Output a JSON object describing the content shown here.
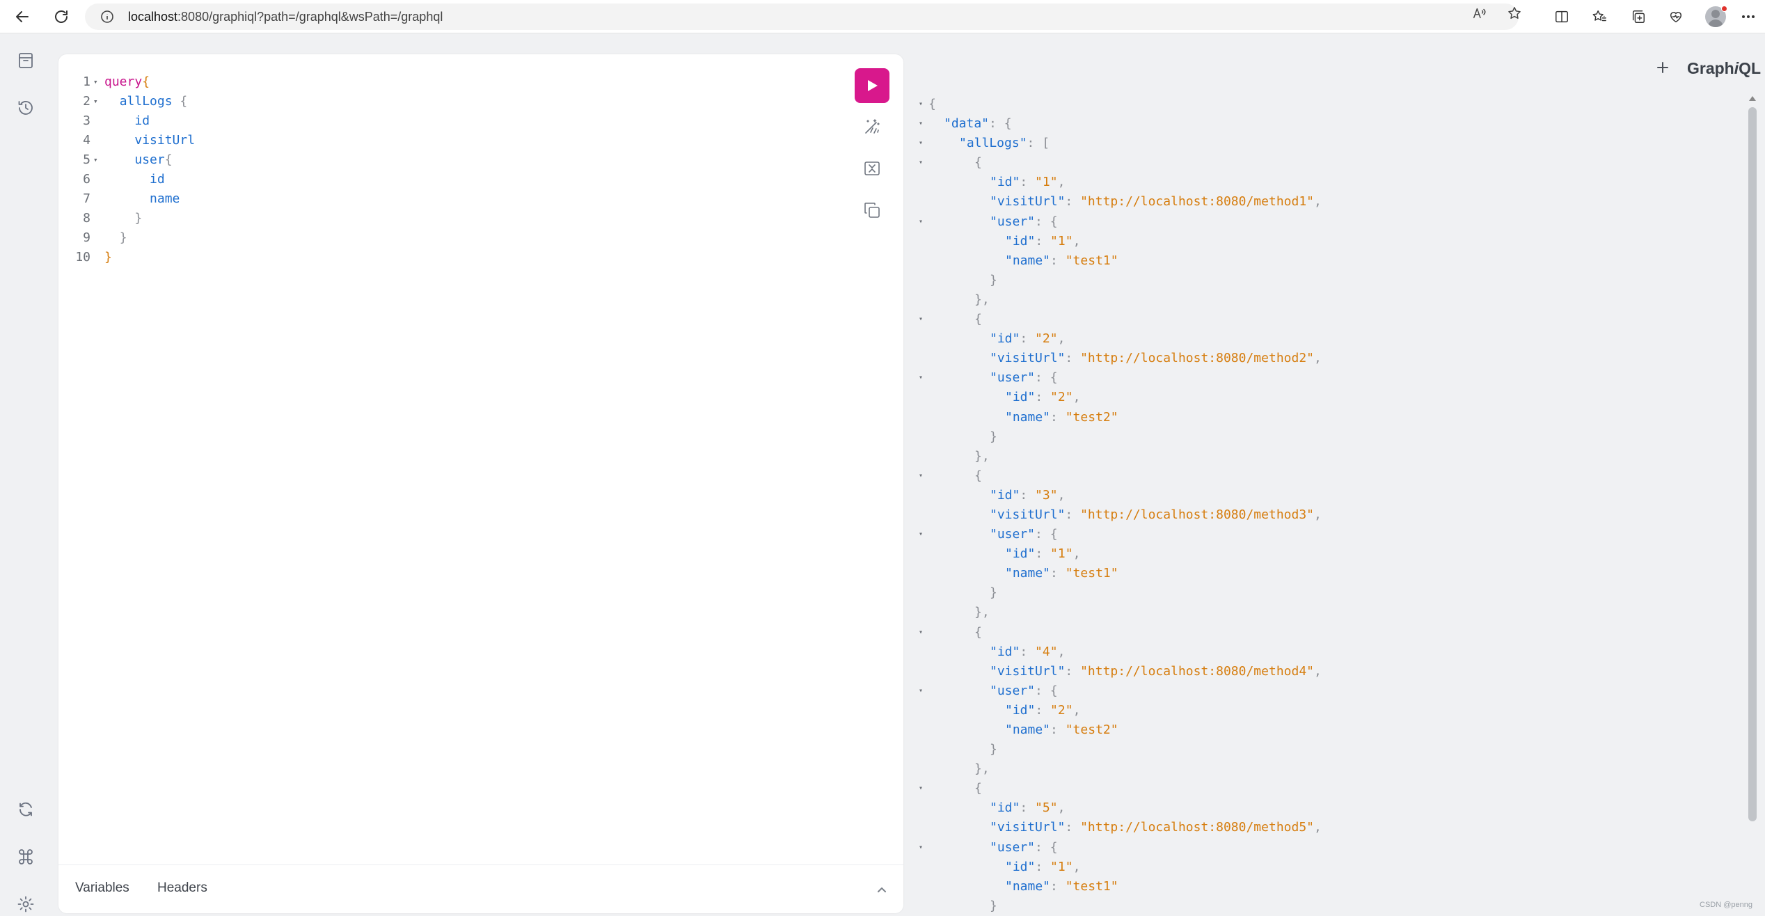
{
  "browser": {
    "url_host": "localhost",
    "url_rest": ":8080/graphiql?path=/graphql&wsPath=/graphql"
  },
  "icons": {
    "back": "back-arrow-icon",
    "reload": "reload-icon",
    "info": "info-icon",
    "read_aloud": "read-aloud-icon",
    "favorite": "star-icon",
    "split": "split-screen-icon",
    "favorites": "favorites-icon",
    "collections": "collections-icon",
    "health": "browser-essentials-icon",
    "docs": "docs-icon",
    "history": "history-icon",
    "refetch": "refetch-schema-icon",
    "shortcuts": "keyboard-shortcuts-icon",
    "settings": "settings-icon",
    "run": "play-icon",
    "prettify": "prettify-icon",
    "merge": "merge-fragments-icon",
    "copy": "copy-icon"
  },
  "editor": {
    "lines": [
      {
        "n": "1",
        "fold": "▾",
        "parts": [
          {
            "t": "query",
            "c": "kw"
          },
          {
            "t": "{",
            "c": "pn-or"
          }
        ]
      },
      {
        "n": "2",
        "fold": "▾",
        "parts": [
          {
            "t": "  ",
            "c": ""
          },
          {
            "t": "allLogs",
            "c": "fd"
          },
          {
            "t": " {",
            "c": "pn"
          }
        ]
      },
      {
        "n": "3",
        "fold": "",
        "parts": [
          {
            "t": "    ",
            "c": ""
          },
          {
            "t": "id",
            "c": "fd"
          }
        ]
      },
      {
        "n": "4",
        "fold": "",
        "parts": [
          {
            "t": "    ",
            "c": ""
          },
          {
            "t": "visitUrl",
            "c": "fd"
          }
        ]
      },
      {
        "n": "5",
        "fold": "▾",
        "parts": [
          {
            "t": "    ",
            "c": ""
          },
          {
            "t": "user",
            "c": "fd"
          },
          {
            "t": "{",
            "c": "pn"
          }
        ]
      },
      {
        "n": "6",
        "fold": "",
        "parts": [
          {
            "t": "      ",
            "c": ""
          },
          {
            "t": "id",
            "c": "fd"
          }
        ]
      },
      {
        "n": "7",
        "fold": "",
        "parts": [
          {
            "t": "      ",
            "c": ""
          },
          {
            "t": "name",
            "c": "fd"
          }
        ]
      },
      {
        "n": "8",
        "fold": "",
        "parts": [
          {
            "t": "    ",
            "c": ""
          },
          {
            "t": "}",
            "c": "pn"
          }
        ]
      },
      {
        "n": "9",
        "fold": "",
        "parts": [
          {
            "t": "  ",
            "c": ""
          },
          {
            "t": "}",
            "c": "pn"
          }
        ]
      },
      {
        "n": "10",
        "fold": "",
        "parts": [
          {
            "t": "}",
            "c": "pn-or"
          }
        ]
      }
    ],
    "tabs": {
      "variables": "Variables",
      "headers": "Headers"
    }
  },
  "result": {
    "logo_prefix": "Graph",
    "logo_italic": "i",
    "logo_suffix": "QL",
    "lines": [
      {
        "fold": "▾",
        "indent": 0,
        "parts": [
          {
            "t": "{",
            "c": ""
          }
        ]
      },
      {
        "fold": "▾",
        "indent": 1,
        "parts": [
          {
            "t": "\"data\"",
            "c": "jk"
          },
          {
            "t": ": {",
            "c": ""
          }
        ]
      },
      {
        "fold": "▾",
        "indent": 2,
        "parts": [
          {
            "t": "\"allLogs\"",
            "c": "jk"
          },
          {
            "t": ": [",
            "c": ""
          }
        ]
      },
      {
        "fold": "▾",
        "indent": 3,
        "parts": [
          {
            "t": "{",
            "c": ""
          }
        ]
      },
      {
        "fold": "",
        "indent": 4,
        "parts": [
          {
            "t": "\"id\"",
            "c": "jk"
          },
          {
            "t": ": ",
            "c": ""
          },
          {
            "t": "\"1\"",
            "c": "js"
          },
          {
            "t": ",",
            "c": ""
          }
        ]
      },
      {
        "fold": "",
        "indent": 4,
        "parts": [
          {
            "t": "\"visitUrl\"",
            "c": "jk"
          },
          {
            "t": ": ",
            "c": ""
          },
          {
            "t": "\"http://localhost:8080/method1\"",
            "c": "js"
          },
          {
            "t": ",",
            "c": ""
          }
        ]
      },
      {
        "fold": "▾",
        "indent": 4,
        "parts": [
          {
            "t": "\"user\"",
            "c": "jk"
          },
          {
            "t": ": {",
            "c": ""
          }
        ]
      },
      {
        "fold": "",
        "indent": 5,
        "parts": [
          {
            "t": "\"id\"",
            "c": "jk"
          },
          {
            "t": ": ",
            "c": ""
          },
          {
            "t": "\"1\"",
            "c": "js"
          },
          {
            "t": ",",
            "c": ""
          }
        ]
      },
      {
        "fold": "",
        "indent": 5,
        "parts": [
          {
            "t": "\"name\"",
            "c": "jk"
          },
          {
            "t": ": ",
            "c": ""
          },
          {
            "t": "\"test1\"",
            "c": "js"
          }
        ]
      },
      {
        "fold": "",
        "indent": 4,
        "parts": [
          {
            "t": "}",
            "c": ""
          }
        ]
      },
      {
        "fold": "",
        "indent": 3,
        "parts": [
          {
            "t": "},",
            "c": ""
          }
        ]
      },
      {
        "fold": "▾",
        "indent": 3,
        "parts": [
          {
            "t": "{",
            "c": ""
          }
        ]
      },
      {
        "fold": "",
        "indent": 4,
        "parts": [
          {
            "t": "\"id\"",
            "c": "jk"
          },
          {
            "t": ": ",
            "c": ""
          },
          {
            "t": "\"2\"",
            "c": "js"
          },
          {
            "t": ",",
            "c": ""
          }
        ]
      },
      {
        "fold": "",
        "indent": 4,
        "parts": [
          {
            "t": "\"visitUrl\"",
            "c": "jk"
          },
          {
            "t": ": ",
            "c": ""
          },
          {
            "t": "\"http://localhost:8080/method2\"",
            "c": "js"
          },
          {
            "t": ",",
            "c": ""
          }
        ]
      },
      {
        "fold": "▾",
        "indent": 4,
        "parts": [
          {
            "t": "\"user\"",
            "c": "jk"
          },
          {
            "t": ": {",
            "c": ""
          }
        ]
      },
      {
        "fold": "",
        "indent": 5,
        "parts": [
          {
            "t": "\"id\"",
            "c": "jk"
          },
          {
            "t": ": ",
            "c": ""
          },
          {
            "t": "\"2\"",
            "c": "js"
          },
          {
            "t": ",",
            "c": ""
          }
        ]
      },
      {
        "fold": "",
        "indent": 5,
        "parts": [
          {
            "t": "\"name\"",
            "c": "jk"
          },
          {
            "t": ": ",
            "c": ""
          },
          {
            "t": "\"test2\"",
            "c": "js"
          }
        ]
      },
      {
        "fold": "",
        "indent": 4,
        "parts": [
          {
            "t": "}",
            "c": ""
          }
        ]
      },
      {
        "fold": "",
        "indent": 3,
        "parts": [
          {
            "t": "},",
            "c": ""
          }
        ]
      },
      {
        "fold": "▾",
        "indent": 3,
        "parts": [
          {
            "t": "{",
            "c": ""
          }
        ]
      },
      {
        "fold": "",
        "indent": 4,
        "parts": [
          {
            "t": "\"id\"",
            "c": "jk"
          },
          {
            "t": ": ",
            "c": ""
          },
          {
            "t": "\"3\"",
            "c": "js"
          },
          {
            "t": ",",
            "c": ""
          }
        ]
      },
      {
        "fold": "",
        "indent": 4,
        "parts": [
          {
            "t": "\"visitUrl\"",
            "c": "jk"
          },
          {
            "t": ": ",
            "c": ""
          },
          {
            "t": "\"http://localhost:8080/method3\"",
            "c": "js"
          },
          {
            "t": ",",
            "c": ""
          }
        ]
      },
      {
        "fold": "▾",
        "indent": 4,
        "parts": [
          {
            "t": "\"user\"",
            "c": "jk"
          },
          {
            "t": ": {",
            "c": ""
          }
        ]
      },
      {
        "fold": "",
        "indent": 5,
        "parts": [
          {
            "t": "\"id\"",
            "c": "jk"
          },
          {
            "t": ": ",
            "c": ""
          },
          {
            "t": "\"1\"",
            "c": "js"
          },
          {
            "t": ",",
            "c": ""
          }
        ]
      },
      {
        "fold": "",
        "indent": 5,
        "parts": [
          {
            "t": "\"name\"",
            "c": "jk"
          },
          {
            "t": ": ",
            "c": ""
          },
          {
            "t": "\"test1\"",
            "c": "js"
          }
        ]
      },
      {
        "fold": "",
        "indent": 4,
        "parts": [
          {
            "t": "}",
            "c": ""
          }
        ]
      },
      {
        "fold": "",
        "indent": 3,
        "parts": [
          {
            "t": "},",
            "c": ""
          }
        ]
      },
      {
        "fold": "▾",
        "indent": 3,
        "parts": [
          {
            "t": "{",
            "c": ""
          }
        ]
      },
      {
        "fold": "",
        "indent": 4,
        "parts": [
          {
            "t": "\"id\"",
            "c": "jk"
          },
          {
            "t": ": ",
            "c": ""
          },
          {
            "t": "\"4\"",
            "c": "js"
          },
          {
            "t": ",",
            "c": ""
          }
        ]
      },
      {
        "fold": "",
        "indent": 4,
        "parts": [
          {
            "t": "\"visitUrl\"",
            "c": "jk"
          },
          {
            "t": ": ",
            "c": ""
          },
          {
            "t": "\"http://localhost:8080/method4\"",
            "c": "js"
          },
          {
            "t": ",",
            "c": ""
          }
        ]
      },
      {
        "fold": "▾",
        "indent": 4,
        "parts": [
          {
            "t": "\"user\"",
            "c": "jk"
          },
          {
            "t": ": {",
            "c": ""
          }
        ]
      },
      {
        "fold": "",
        "indent": 5,
        "parts": [
          {
            "t": "\"id\"",
            "c": "jk"
          },
          {
            "t": ": ",
            "c": ""
          },
          {
            "t": "\"2\"",
            "c": "js"
          },
          {
            "t": ",",
            "c": ""
          }
        ]
      },
      {
        "fold": "",
        "indent": 5,
        "parts": [
          {
            "t": "\"name\"",
            "c": "jk"
          },
          {
            "t": ": ",
            "c": ""
          },
          {
            "t": "\"test2\"",
            "c": "js"
          }
        ]
      },
      {
        "fold": "",
        "indent": 4,
        "parts": [
          {
            "t": "}",
            "c": ""
          }
        ]
      },
      {
        "fold": "",
        "indent": 3,
        "parts": [
          {
            "t": "},",
            "c": ""
          }
        ]
      },
      {
        "fold": "▾",
        "indent": 3,
        "parts": [
          {
            "t": "{",
            "c": ""
          }
        ]
      },
      {
        "fold": "",
        "indent": 4,
        "parts": [
          {
            "t": "\"id\"",
            "c": "jk"
          },
          {
            "t": ": ",
            "c": ""
          },
          {
            "t": "\"5\"",
            "c": "js"
          },
          {
            "t": ",",
            "c": ""
          }
        ]
      },
      {
        "fold": "",
        "indent": 4,
        "parts": [
          {
            "t": "\"visitUrl\"",
            "c": "jk"
          },
          {
            "t": ": ",
            "c": ""
          },
          {
            "t": "\"http://localhost:8080/method5\"",
            "c": "js"
          },
          {
            "t": ",",
            "c": ""
          }
        ]
      },
      {
        "fold": "▾",
        "indent": 4,
        "parts": [
          {
            "t": "\"user\"",
            "c": "jk"
          },
          {
            "t": ": {",
            "c": ""
          }
        ]
      },
      {
        "fold": "",
        "indent": 5,
        "parts": [
          {
            "t": "\"id\"",
            "c": "jk"
          },
          {
            "t": ": ",
            "c": ""
          },
          {
            "t": "\"1\"",
            "c": "js"
          },
          {
            "t": ",",
            "c": ""
          }
        ]
      },
      {
        "fold": "",
        "indent": 5,
        "parts": [
          {
            "t": "\"name\"",
            "c": "jk"
          },
          {
            "t": ": ",
            "c": ""
          },
          {
            "t": "\"test1\"",
            "c": "js"
          }
        ]
      },
      {
        "fold": "",
        "indent": 4,
        "parts": [
          {
            "t": "}",
            "c": ""
          }
        ]
      }
    ]
  },
  "watermark": "CSDN @penng",
  "colors": {
    "accent": "#d8188c",
    "keyword": "#c8148c",
    "field": "#1f6fcf",
    "string": "#d67d0e",
    "punctuation": "#8c8f95"
  }
}
